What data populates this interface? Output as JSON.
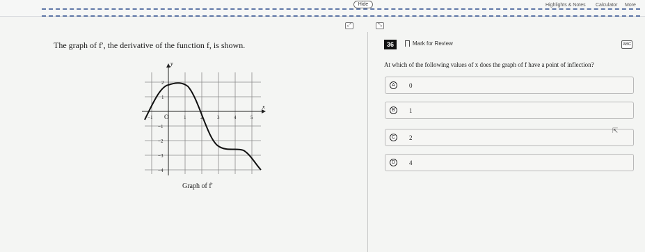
{
  "toolbar": {
    "hide_label": "Hide",
    "highlights_label": "Highlights & Notes",
    "calculator_label": "Calculator",
    "more_label": "More"
  },
  "left_pane": {
    "prompt": "The graph of f′, the derivative of the function f, is shown.",
    "graph_caption": "Graph of f′",
    "graph": {
      "y_axis_label": "y",
      "x_axis_label": "x",
      "x_ticks": [
        "−1",
        "O",
        "1",
        "2",
        "3",
        "4",
        "5"
      ],
      "y_ticks": [
        "2",
        "1",
        "−1",
        "−2",
        "−3",
        "−4"
      ]
    }
  },
  "right_pane": {
    "question_number": "36",
    "mark_for_review": "Mark for Review",
    "abc_label": "ABC",
    "question": "At which of the following values of x does the graph of f have a point of inflection?",
    "choices": [
      {
        "letter": "A",
        "value": "0"
      },
      {
        "letter": "B",
        "value": "1"
      },
      {
        "letter": "C",
        "value": "2"
      },
      {
        "letter": "D",
        "value": "4"
      }
    ]
  },
  "icons": {
    "expand_left": "expand-icon",
    "expand_right": "collapse-icon",
    "bookmark": "bookmark-icon",
    "abc": "abc-icon",
    "cursor": "mouse-cursor-icon"
  }
}
